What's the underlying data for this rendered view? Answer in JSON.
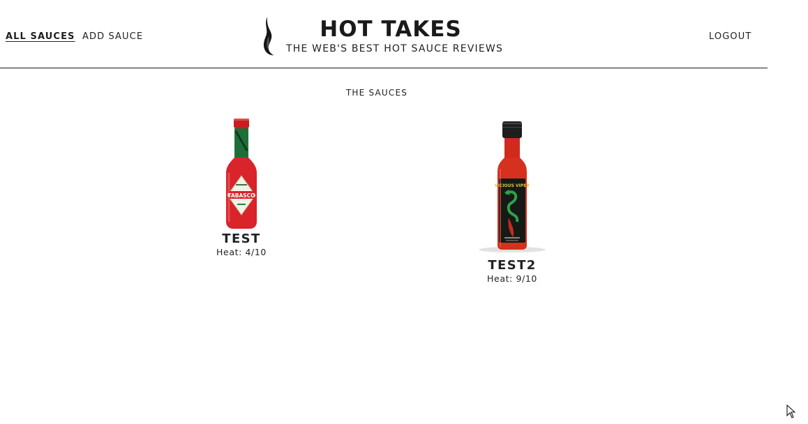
{
  "nav": {
    "all_sauces": "ALL SAUCES",
    "add_sauce": "ADD SAUCE",
    "logout": "LOGOUT"
  },
  "brand": {
    "title": "HOT TAKES",
    "subtitle": "THE WEB'S BEST HOT SAUCE REVIEWS",
    "logo_icon": "flame-icon"
  },
  "main": {
    "heading": "THE SAUCES",
    "sauces": [
      {
        "name": "TEST",
        "heat": "Heat: 4/10",
        "image": "tabasco-bottle",
        "label_text": "TABASCO"
      },
      {
        "name": "TEST2",
        "heat": "Heat: 9/10",
        "image": "vicious-viper-bottle",
        "label_text": "VICIOUS VIPER"
      }
    ]
  },
  "colors": {
    "text": "#1f1f1f",
    "divider": "#1a1a1a",
    "background": "#ffffff"
  }
}
